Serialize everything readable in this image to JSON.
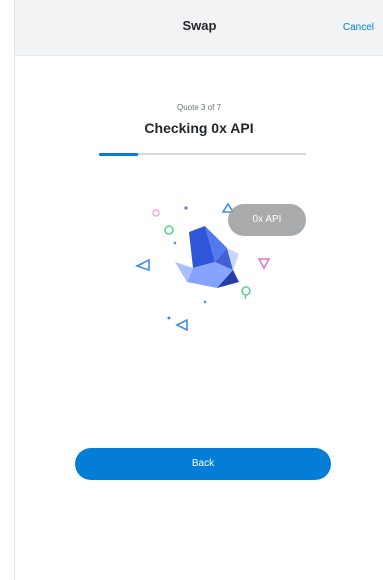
{
  "header": {
    "title": "Swap",
    "cancel_label": "Cancel"
  },
  "quote": {
    "counter": "Quote 3 of 7",
    "status": "Checking 0x API",
    "progress_fraction": 0.19
  },
  "aggregator": {
    "label": "0x API"
  },
  "footer": {
    "back_label": "Back"
  },
  "colors": {
    "accent": "#037dd6",
    "header_bg": "#f2f3f4"
  }
}
